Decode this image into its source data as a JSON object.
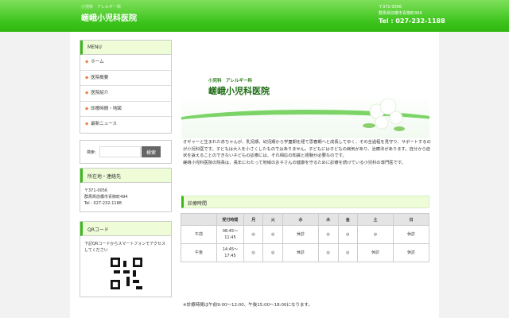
{
  "header": {
    "subtitle": "小児科　アレルギー科",
    "title": "嵯峨小児科医院",
    "postal": "〒371-0056",
    "address": "群馬県前橋市青柳町494",
    "tel": "Tel : 027-232-1188"
  },
  "sidebar": {
    "menu_title": "MENU",
    "menu": [
      "ホーム",
      "医院概要",
      "医院紹介",
      "診療時間・地図",
      "最新ニュース"
    ],
    "search_label": "検索:",
    "search_placeholder": "",
    "search_button": "検索",
    "contact_title": "所在地・連絡先",
    "contact": [
      "〒371-0056",
      "群馬県前橋市青柳町494",
      "Tel : 027-232-1188"
    ],
    "qr_title": "QRコード",
    "qr_text": "下記QRコードからスマートフォンでアクセスしてください"
  },
  "hero": {
    "subtitle": "小児科　アレルギー科",
    "name": "嵯峨小児科医院"
  },
  "intro": [
    "オギャーと生まれた赤ちゃんが、乳児期、幼児期から学童期を経て思春期へと成長してゆく、その全過程を見守り、サポートするのが小児科医です。子どもは大人を小さくしたものではありません。子どもには子どもの病気があり、治療法があります。自分から症状を訴えることのできない子どもの診療には、それ相応の知識と経験が必要なのです。",
    "嵯峨小児科医院の院長は、長年にわたって地域のお子さんの健康を守るために診療を続けている小児科の専門医です。"
  ],
  "hours": {
    "title": "診療時間",
    "headers": [
      "",
      "受付時間",
      "月",
      "火",
      "水",
      "木",
      "金",
      "土",
      "日"
    ],
    "rows": [
      [
        "午前",
        "08:45～11:45",
        "◎",
        "◎",
        "休診",
        "◎",
        "◎",
        "◎",
        "休診"
      ],
      [
        "午後",
        "14:45～17:45",
        "◎",
        "◎",
        "休診",
        "◎",
        "◎",
        "休診",
        "休診"
      ]
    ],
    "note": "※診療時間は午前9:00～12:00、午後15:00～18:00になります。"
  },
  "colors": {
    "accent": "#3cc41c"
  }
}
